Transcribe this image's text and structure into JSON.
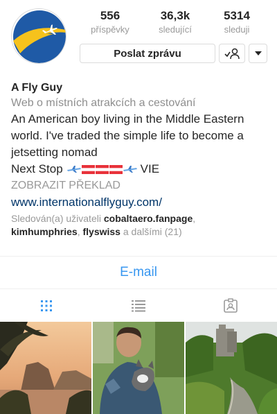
{
  "profile": {
    "stats": [
      {
        "value": "556",
        "label": "příspěvky"
      },
      {
        "value": "36,3k",
        "label": "sledující"
      },
      {
        "value": "5314",
        "label": "sleduji"
      }
    ],
    "message_button": "Poslat zprávu",
    "name": "A Fly Guy",
    "category": "Web o místních atrakcích a cestování",
    "bio_lines": [
      "An American boy living in the Middle Eastern",
      "world. I've traded the simple life to become a",
      "jetsetting nomad"
    ],
    "next_stop_label": "Next Stop",
    "next_stop_dest": "VIE",
    "translate": "ZOBRAZIT PŘEKLAD",
    "website": "www.internationalflyguy.com/",
    "followed_by": {
      "prefix": "Sledován(a) uživateli",
      "users": [
        "cobaltaero.fanpage",
        "kimhumphries",
        "flyswiss"
      ],
      "suffix": "a dalšími (21)"
    }
  },
  "email_button": "E-mail",
  "tabs": [
    "grid-icon",
    "list-icon",
    "tagged-icon"
  ],
  "colors": {
    "accent": "#3897f0",
    "logo_blue": "#1f5aa6",
    "logo_yellow": "#f6c21c",
    "muted": "#999999"
  }
}
